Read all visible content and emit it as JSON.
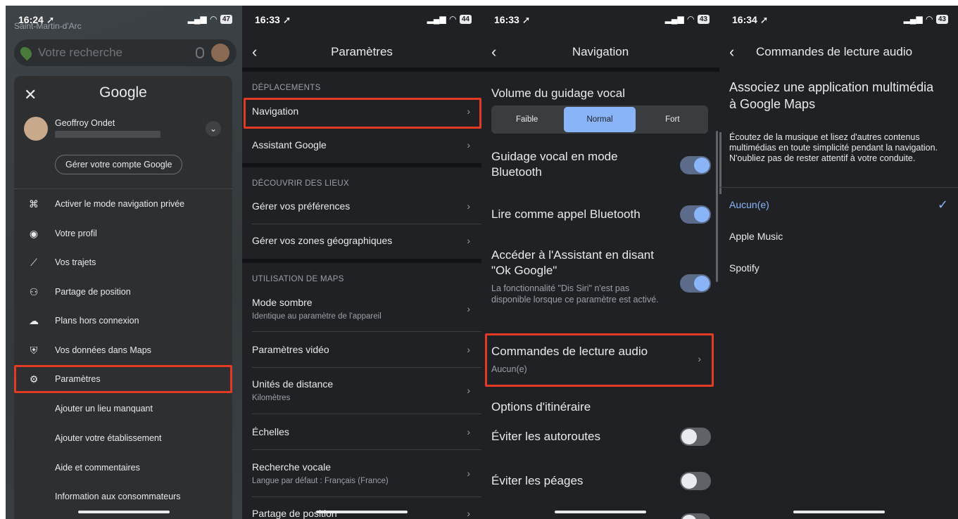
{
  "panel1": {
    "status": {
      "time": "16:24 ➚",
      "signal": "▂▄▆",
      "wifi": "◠",
      "battery": "47"
    },
    "map_label": "Saint-Martin-d'Arc",
    "search": {
      "placeholder": "Votre recherche"
    },
    "menu": {
      "close": "✕",
      "brand": "Google",
      "account_name": "Geoffroy Ondet",
      "expand": "⌄",
      "manage_account": "Gérer votre compte Google",
      "items": [
        {
          "icon": "⌘",
          "label": "Activer le mode navigation privée"
        },
        {
          "icon": "◉",
          "label": "Votre profil"
        },
        {
          "icon": "⟋",
          "label": "Vos trajets"
        },
        {
          "icon": "⚇",
          "label": "Partage de position"
        },
        {
          "icon": "☁",
          "label": "Plans hors connexion"
        },
        {
          "icon": "⛨",
          "label": "Vos données dans Maps"
        },
        {
          "icon": "⚙",
          "label": "Paramètres"
        },
        {
          "icon": "",
          "label": "Ajouter un lieu manquant"
        },
        {
          "icon": "",
          "label": "Ajouter votre établissement"
        },
        {
          "icon": "",
          "label": "Aide et commentaires"
        },
        {
          "icon": "",
          "label": "Information aux consommateurs"
        }
      ]
    }
  },
  "panel2": {
    "status": {
      "time": "16:33 ➚",
      "signal": "▂▄▆",
      "wifi": "◠",
      "battery": "44"
    },
    "title": "Paramètres",
    "back": "‹",
    "sections": {
      "deplacements": "DÉPLACEMENTS",
      "decouvrir": "DÉCOUVRIR DES LIEUX",
      "utilisation": "UTILISATION DE MAPS"
    },
    "rows": {
      "navigation": "Navigation",
      "assistant": "Assistant Google",
      "preferences": "Gérer vos préférences",
      "zones": "Gérer vos zones géographiques",
      "mode_sombre": "Mode sombre",
      "mode_sombre_sub": "Identique au paramètre de l'appareil",
      "video": "Paramètres vidéo",
      "unites": "Unités de distance",
      "unites_sub": "Kilomètres",
      "echelles": "Échelles",
      "recherche": "Recherche vocale",
      "recherche_sub": "Langue par défaut : Français (France)",
      "partage": "Partage de position"
    },
    "chevron": "›"
  },
  "panel3": {
    "status": {
      "time": "16:33 ➚",
      "signal": "▂▄▆",
      "wifi": "◠",
      "battery": "43"
    },
    "title": "Navigation",
    "back": "‹",
    "volume_title": "Volume du guidage vocal",
    "volume_options": [
      "Faible",
      "Normal",
      "Fort"
    ],
    "volume_selected": "Normal",
    "bluetooth_guidance": "Guidage vocal en mode Bluetooth",
    "bluetooth_call": "Lire comme appel Bluetooth",
    "ok_google": "Accéder à l'Assistant en disant \"Ok Google\"",
    "ok_google_sub": "La fonctionnalité \"Dis Siri\" n'est pas disponible lorsque ce paramètre est activé.",
    "audio_controls": "Commandes de lecture audio",
    "audio_controls_sub": "Aucun(e)",
    "route_options": "Options d'itinéraire",
    "avoid_highways": "Éviter les autoroutes",
    "avoid_tolls": "Éviter les péages",
    "toggles": {
      "bluetooth_guidance": true,
      "bluetooth_call": true,
      "ok_google": true,
      "avoid_highways": false,
      "avoid_tolls": false
    },
    "chevron": "›"
  },
  "panel4": {
    "status": {
      "time": "16:34 ➚",
      "signal": "▂▄▆",
      "wifi": "◠",
      "battery": "43"
    },
    "title": "Commandes de lecture audio",
    "back": "‹",
    "heading": "Associez une application multimédia à Google Maps",
    "description": "Écoutez de la musique et lisez d'autres contenus multimédias en toute simplicité pendant la navigation. N'oubliez pas de rester attentif à votre conduite.",
    "options": [
      "Aucun(e)",
      "Apple Music",
      "Spotify"
    ],
    "selected": "Aucun(e)",
    "check": "✓"
  },
  "colors": {
    "highlight": "#e33a24",
    "accent": "#8ab4f8",
    "background": "#202124"
  }
}
